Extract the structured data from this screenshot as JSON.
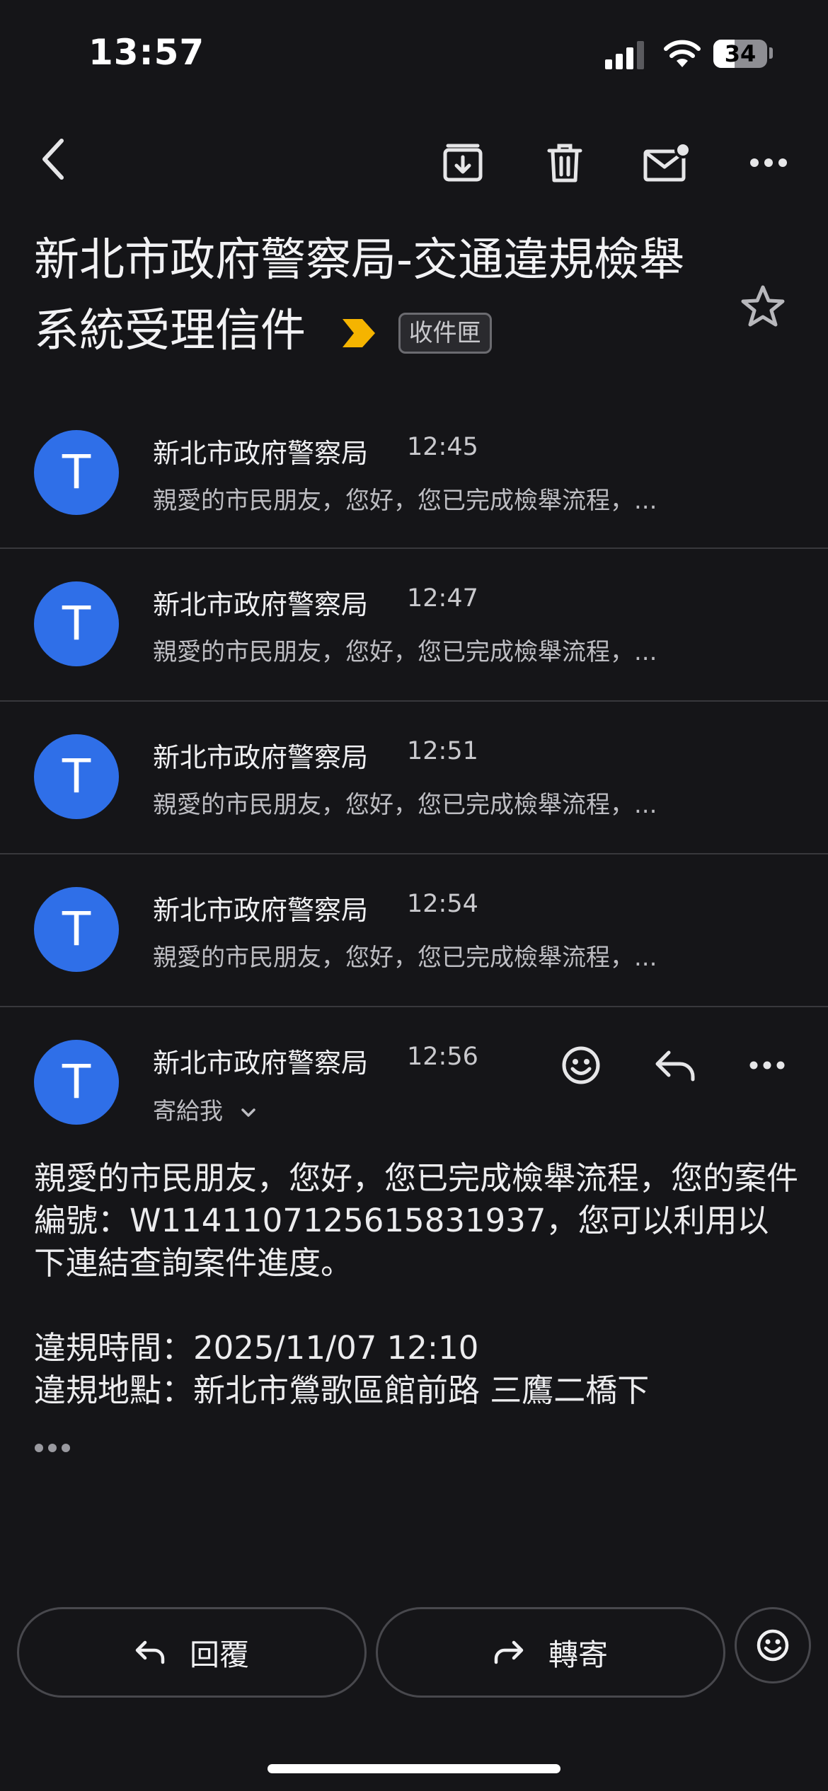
{
  "status_bar": {
    "time": "13:57",
    "battery": "34"
  },
  "toolbar": {
    "back_icon": "chevron-left-icon",
    "archive_icon": "archive-icon",
    "delete_icon": "trash-icon",
    "mark_unread_icon": "mail-unread-icon",
    "more_icon": "more-horizontal-icon"
  },
  "subject": {
    "text": "新北市政府警察局-交通違規檢舉系統受理信件",
    "label": "收件匣",
    "importance_color": "#f5b400"
  },
  "messages": [
    {
      "avatar": "T",
      "sender": "新北市政府警察局",
      "time": "12:45",
      "snippet": "親愛的市民朋友，您好，您已完成檢舉流程，..."
    },
    {
      "avatar": "T",
      "sender": "新北市政府警察局",
      "time": "12:47",
      "snippet": "親愛的市民朋友，您好，您已完成檢舉流程，..."
    },
    {
      "avatar": "T",
      "sender": "新北市政府警察局",
      "time": "12:51",
      "snippet": "親愛的市民朋友，您好，您已完成檢舉流程，..."
    },
    {
      "avatar": "T",
      "sender": "新北市政府警察局",
      "time": "12:54",
      "snippet": "親愛的市民朋友，您好，您已完成檢舉流程，..."
    }
  ],
  "open_message": {
    "avatar": "T",
    "sender": "新北市政府警察局",
    "time": "12:56",
    "to_me": "寄給我",
    "body": "親愛的市民朋友，您好，您已完成檢舉流程，您的案件編號：W1141107125615831937，您可以利用以下連結查詢案件進度。\n\n違規時間：2025/11/07 12:10\n違規地點：新北市鶯歌區館前路 三鷹二橋下"
  },
  "actions": {
    "reply": "回覆",
    "forward": "轉寄"
  },
  "colors": {
    "background": "#151518",
    "avatar": "#2f6fe8",
    "accent": "#f5b400"
  }
}
